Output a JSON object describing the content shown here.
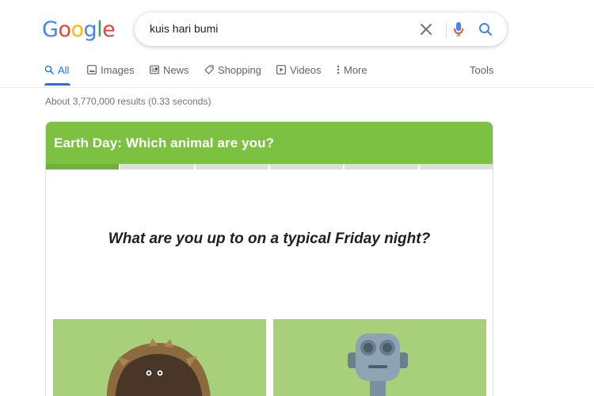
{
  "logo": {
    "letters": [
      {
        "char": "G",
        "color": "#4285F4"
      },
      {
        "char": "o",
        "color": "#EA4335"
      },
      {
        "char": "o",
        "color": "#FBBC05"
      },
      {
        "char": "g",
        "color": "#4285F4"
      },
      {
        "char": "l",
        "color": "#34A853"
      },
      {
        "char": "e",
        "color": "#EA4335"
      }
    ]
  },
  "search": {
    "query": "kuis hari bumi",
    "icons": [
      "close-icon",
      "microphone-icon",
      "search-icon"
    ]
  },
  "tabs": [
    {
      "label": "All",
      "icon": "search-icon",
      "active": true
    },
    {
      "label": "Images",
      "icon": "image-icon"
    },
    {
      "label": "News",
      "icon": "news-icon"
    },
    {
      "label": "Shopping",
      "icon": "tag-icon"
    },
    {
      "label": "Videos",
      "icon": "play-icon"
    },
    {
      "label": "More",
      "icon": "more-vert-icon"
    },
    {
      "label": "Tools"
    }
  ],
  "stats": "About 3,770,000 results (0.33 seconds)",
  "quiz": {
    "title": "Earth Day: Which animal are you?",
    "question": "What are you up to on a typical Friday night?",
    "progress": {
      "completed": 1,
      "total": 6
    },
    "colors": {
      "header": "#7DC143",
      "answer_bg": "#A8D07A",
      "progress_done": "#6FB336"
    }
  }
}
